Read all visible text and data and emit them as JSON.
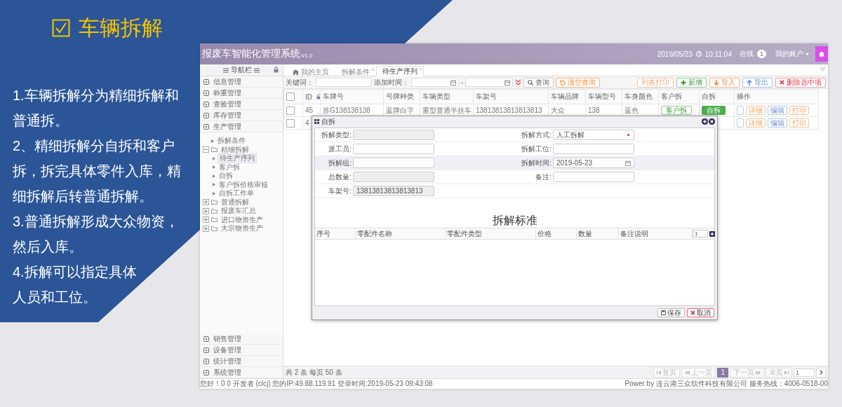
{
  "slide": {
    "title": "车辆拆解",
    "points": [
      "1.车辆拆解分为精细拆解和普通拆。",
      "2、精细拆解分自拆和客户拆，拆完具体零件入库，精细拆解后转普通拆解。",
      "3.普通拆解形成大众物资，然后入库。",
      "4.拆解可以指定具体人员和工位。"
    ]
  },
  "app": {
    "header": {
      "title": "报废车智能化管理系统",
      "version": "V1.0",
      "date": "2019/05/23",
      "time": "10:11:04",
      "online_label": "在线",
      "online_count": "1",
      "account": "我的账户"
    },
    "sidebar": {
      "title": "导航栏",
      "top_items": [
        {
          "label": "信息管理"
        },
        {
          "label": "称重管理"
        },
        {
          "label": "查验管理"
        },
        {
          "label": "库存管理"
        },
        {
          "label": "生产管理"
        }
      ],
      "tree": [
        {
          "label": "拆解条件",
          "kind": "leaf",
          "selected": false
        },
        {
          "label": "精细拆解",
          "kind": "folder",
          "expanded": true,
          "children": [
            {
              "label": "待生产序列",
              "selected": true
            },
            {
              "label": "客户拆",
              "selected": false
            },
            {
              "label": "自拆",
              "selected": false
            },
            {
              "label": "客户拆价格审核",
              "selected": false
            },
            {
              "label": "自拆工作单",
              "selected": false
            }
          ]
        },
        {
          "label": "普通拆解",
          "kind": "folder",
          "expanded": false
        },
        {
          "label": "报废车汇总",
          "kind": "folder",
          "expanded": false
        },
        {
          "label": "进口物资生产",
          "kind": "folder",
          "expanded": false
        },
        {
          "label": "大宗物资生产",
          "kind": "folder",
          "expanded": false
        }
      ],
      "bottom_items": [
        {
          "label": "销售管理"
        },
        {
          "label": "设备管理"
        },
        {
          "label": "统计管理"
        },
        {
          "label": "系统管理"
        }
      ]
    },
    "tabs": [
      {
        "label": "我的主页",
        "kind": "home",
        "selected": false
      },
      {
        "label": "拆解条件",
        "kind": "closable",
        "selected": false
      },
      {
        "label": "待生产序列",
        "kind": "closable",
        "selected": true
      }
    ],
    "toolbar": {
      "keyword_label": "关键词：",
      "date_label": "添加时间：",
      "date_separator": "-",
      "search_button": "查询",
      "clear_button": "清空查询",
      "actions": [
        {
          "label": "列表打印",
          "kind": "print"
        },
        {
          "label": "新增",
          "kind": "add"
        },
        {
          "label": "导入",
          "kind": "import"
        },
        {
          "label": "导出",
          "kind": "export"
        },
        {
          "label": "删除选中项",
          "kind": "delete"
        }
      ]
    },
    "table": {
      "select_all": {
        "checked": false
      },
      "columns": [
        {
          "label": "ID",
          "sortable": true
        },
        {
          "label": "车牌号",
          "sortable": false
        },
        {
          "label": "号牌种类",
          "sortable": false
        },
        {
          "label": "车辆类型",
          "sortable": false
        },
        {
          "label": "车架号",
          "sortable": false
        },
        {
          "label": "车辆品牌",
          "sortable": false
        },
        {
          "label": "车辆型号",
          "sortable": false
        },
        {
          "label": "车身颜色",
          "sortable": false
        },
        {
          "label": "客户拆",
          "sortable": false
        },
        {
          "label": "自拆",
          "sortable": false
        },
        {
          "label": "操作",
          "sortable": false
        }
      ],
      "rows": [
        {
          "checked": false,
          "cells": [
            "45",
            "苏G138138138",
            "蓝牌白字",
            "重型普通半挂车",
            "13813813813813813",
            "大众",
            "138",
            "蓝色"
          ],
          "customer_button": "客户拆",
          "self_button": "自拆",
          "actions": [
            "详细",
            "编辑",
            "打印"
          ]
        },
        {
          "checked": false,
          "cells": [
            "4"
          ],
          "actions": [
            "详细",
            "编辑",
            "打印"
          ]
        }
      ]
    },
    "dialog": {
      "title": "自拆",
      "rows": [
        {
          "highlighted": false,
          "fields": [
            {
              "label": "拆解类型:",
              "disabled": true,
              "kind": "text"
            },
            {
              "label": "拆解方式:",
              "value": "人工拆解",
              "required": true,
              "kind": "text"
            }
          ]
        },
        {
          "highlighted": false,
          "fields": [
            {
              "label": "派工员:",
              "kind": "text"
            },
            {
              "label": "拆解工位:",
              "kind": "text"
            }
          ]
        },
        {
          "highlighted": true,
          "fields": [
            {
              "label": "拆解组:",
              "kind": "text"
            },
            {
              "label": "拆解时间:",
              "value": "2019-05-23",
              "kind": "date"
            }
          ]
        },
        {
          "highlighted": false,
          "fields": [
            {
              "label": "总数量:",
              "disabled": true,
              "kind": "text"
            },
            {
              "label": "备注:",
              "kind": "text"
            }
          ]
        },
        {
          "highlighted": false,
          "fields": [
            {
              "label": "车架号:",
              "value": "13813813813813813",
              "disabled": true,
              "kind": "text"
            }
          ]
        }
      ],
      "section_title": "拆解标准",
      "columns": [
        "序号",
        "零配件名称",
        "零配件类型",
        "价格",
        "数量",
        "备注说明"
      ],
      "count": "1",
      "buttons": [
        {
          "label": "保存",
          "kind": "save"
        },
        {
          "label": "取消",
          "kind": "cancel"
        }
      ]
    },
    "pager": {
      "summary": "共 2 条 每页 50 条",
      "buttons": [
        {
          "label": "首页",
          "kind": "first",
          "disabled": true
        },
        {
          "label": "上一页",
          "kind": "prev",
          "disabled": true
        },
        {
          "label": "1",
          "kind": "page",
          "selected": true
        },
        {
          "label": "下一页",
          "kind": "next",
          "disabled": true
        },
        {
          "label": "末页",
          "kind": "last",
          "disabled": true
        }
      ],
      "page_input": "1"
    },
    "status_bar": {
      "left": "您好！0 0 开发者 (clcj) 您的IP:49.88.119.91 登录时间:2019-05-23 09:43:08",
      "right": "Power by 连云港三众软件科技有限公司 服务热线：4006-0518-00"
    }
  }
}
